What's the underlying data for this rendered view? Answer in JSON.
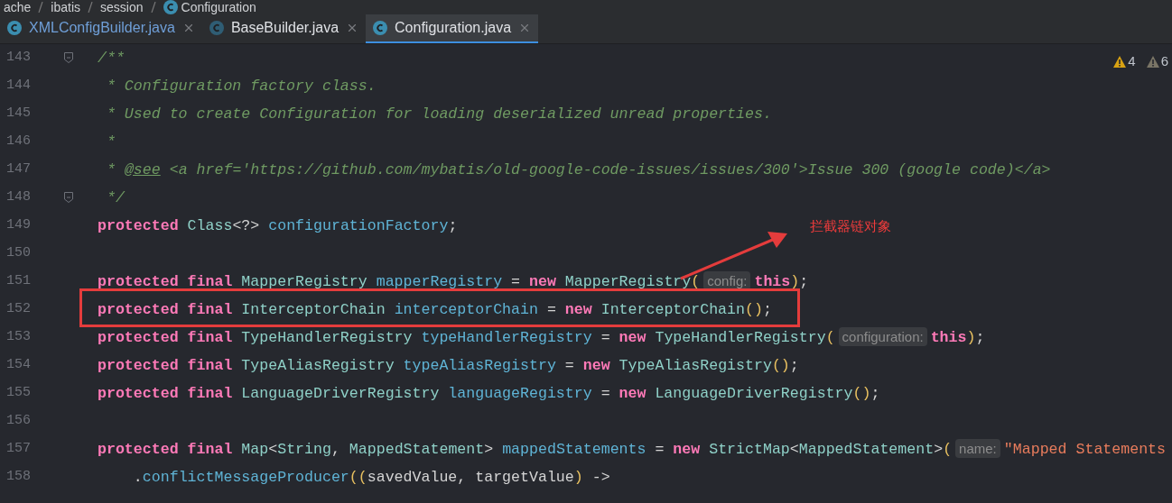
{
  "breadcrumbs": [
    {
      "text": "ache",
      "icon": false
    },
    {
      "text": "ibatis",
      "icon": false
    },
    {
      "text": "session",
      "icon": false
    },
    {
      "text": "Configuration",
      "icon": true
    }
  ],
  "tabs": [
    {
      "label": "XMLConfigBuilder.java",
      "selected": false,
      "modified": true
    },
    {
      "label": "BaseBuilder.java",
      "selected": false,
      "modified": false
    },
    {
      "label": "Configuration.java",
      "selected": true,
      "modified": false
    }
  ],
  "inspections": [
    {
      "kind": "warning",
      "count": "4"
    },
    {
      "kind": "weak",
      "count": "6"
    }
  ],
  "lines": [
    {
      "number": "143",
      "fold": true,
      "tokens": [
        {
          "kind": "comment",
          "text": "/**"
        }
      ]
    },
    {
      "number": "144",
      "fold": false,
      "tokens": [
        {
          "kind": "comment",
          "text": " * Configuration factory class."
        }
      ]
    },
    {
      "number": "145",
      "fold": false,
      "tokens": [
        {
          "kind": "comment",
          "text": " * Used to create Configuration for loading deserialized unread properties."
        }
      ]
    },
    {
      "number": "146",
      "fold": false,
      "tokens": [
        {
          "kind": "comment",
          "text": " *"
        }
      ]
    },
    {
      "number": "147",
      "fold": false,
      "tokens": [
        {
          "kind": "comment",
          "text": " * "
        },
        {
          "kind": "tag",
          "text": "@see"
        },
        {
          "kind": "comment",
          "text": " <a href='https://github.com/mybatis/old-google-code-issues/issues/300'>Issue 300 (google code)</a>"
        }
      ]
    },
    {
      "number": "148",
      "fold": true,
      "tokens": [
        {
          "kind": "comment",
          "text": " */"
        }
      ]
    },
    {
      "number": "149",
      "fold": false,
      "tokens": [
        {
          "kind": "keyword",
          "text": "protected "
        },
        {
          "kind": "type",
          "text": "Class"
        },
        {
          "kind": "plain",
          "text": "<?> "
        },
        {
          "kind": "field",
          "text": "configurationFactory"
        },
        {
          "kind": "plain",
          "text": ";"
        }
      ]
    },
    {
      "number": "150",
      "fold": false
    },
    {
      "number": "151",
      "fold": false,
      "tokens": [
        {
          "kind": "keyword",
          "text": "protected final "
        },
        {
          "kind": "type",
          "text": "MapperRegistry "
        },
        {
          "kind": "field",
          "text": "mapperRegistry"
        },
        {
          "kind": "plain",
          "text": " = "
        },
        {
          "kind": "keyword",
          "text": "new "
        },
        {
          "kind": "type",
          "text": "MapperRegistry"
        },
        {
          "kind": "paren",
          "text": "("
        },
        {
          "kind": "hint",
          "text": "config:"
        },
        {
          "kind": "keyword",
          "text": "this"
        },
        {
          "kind": "paren",
          "text": ")"
        },
        {
          "kind": "plain",
          "text": ";"
        }
      ]
    },
    {
      "number": "152",
      "fold": false,
      "tokens": [
        {
          "kind": "keyword",
          "text": "protected final "
        },
        {
          "kind": "type",
          "text": "InterceptorChain "
        },
        {
          "kind": "field",
          "text": "interceptorChain"
        },
        {
          "kind": "plain",
          "text": " = "
        },
        {
          "kind": "keyword",
          "text": "new "
        },
        {
          "kind": "type",
          "text": "InterceptorChain"
        },
        {
          "kind": "paren",
          "text": "()"
        },
        {
          "kind": "plain",
          "text": ";"
        }
      ]
    },
    {
      "number": "153",
      "fold": false,
      "tokens": [
        {
          "kind": "keyword",
          "text": "protected final "
        },
        {
          "kind": "type",
          "text": "TypeHandlerRegistry "
        },
        {
          "kind": "field",
          "text": "typeHandlerRegistry"
        },
        {
          "kind": "plain",
          "text": " = "
        },
        {
          "kind": "keyword",
          "text": "new "
        },
        {
          "kind": "type",
          "text": "TypeHandlerRegistry"
        },
        {
          "kind": "paren",
          "text": "("
        },
        {
          "kind": "hint",
          "text": "configuration:"
        },
        {
          "kind": "keyword",
          "text": "this"
        },
        {
          "kind": "paren",
          "text": ")"
        },
        {
          "kind": "plain",
          "text": ";"
        }
      ]
    },
    {
      "number": "154",
      "fold": false,
      "tokens": [
        {
          "kind": "keyword",
          "text": "protected final "
        },
        {
          "kind": "type",
          "text": "TypeAliasRegistry "
        },
        {
          "kind": "field",
          "text": "typeAliasRegistry"
        },
        {
          "kind": "plain",
          "text": " = "
        },
        {
          "kind": "keyword",
          "text": "new "
        },
        {
          "kind": "type",
          "text": "TypeAliasRegistry"
        },
        {
          "kind": "paren",
          "text": "()"
        },
        {
          "kind": "plain",
          "text": ";"
        }
      ]
    },
    {
      "number": "155",
      "fold": false,
      "tokens": [
        {
          "kind": "keyword",
          "text": "protected final "
        },
        {
          "kind": "type",
          "text": "LanguageDriverRegistry "
        },
        {
          "kind": "field",
          "text": "languageRegistry"
        },
        {
          "kind": "plain",
          "text": " = "
        },
        {
          "kind": "keyword",
          "text": "new "
        },
        {
          "kind": "type",
          "text": "LanguageDriverRegistry"
        },
        {
          "kind": "paren",
          "text": "()"
        },
        {
          "kind": "plain",
          "text": ";"
        }
      ]
    },
    {
      "number": "156",
      "fold": false
    },
    {
      "number": "157",
      "fold": false,
      "tokens": [
        {
          "kind": "keyword",
          "text": "protected final "
        },
        {
          "kind": "type",
          "text": "Map"
        },
        {
          "kind": "plain",
          "text": "<"
        },
        {
          "kind": "type",
          "text": "String"
        },
        {
          "kind": "plain",
          "text": ", "
        },
        {
          "kind": "type",
          "text": "MappedStatement"
        },
        {
          "kind": "plain",
          "text": "> "
        },
        {
          "kind": "field",
          "text": "mappedStatements"
        },
        {
          "kind": "plain",
          "text": " = "
        },
        {
          "kind": "keyword",
          "text": "new "
        },
        {
          "kind": "type",
          "text": "StrictMap"
        },
        {
          "kind": "plain",
          "text": "<"
        },
        {
          "kind": "type",
          "text": "MappedStatement"
        },
        {
          "kind": "plain",
          "text": ">"
        },
        {
          "kind": "paren",
          "text": "("
        },
        {
          "kind": "hint",
          "text": "name:"
        },
        {
          "kind": "string",
          "text": "\"Mapped Statements"
        }
      ]
    },
    {
      "number": "158",
      "fold": false,
      "tokens": [
        {
          "kind": "plain",
          "text": "    ."
        },
        {
          "kind": "method",
          "text": "conflictMessageProducer"
        },
        {
          "kind": "paren",
          "text": "(("
        },
        {
          "kind": "plain",
          "text": "savedValue, targetValue"
        },
        {
          "kind": "paren",
          "text": ")"
        },
        {
          "kind": "plain",
          "text": " ->"
        }
      ]
    }
  ],
  "annotation": {
    "text": "拦截器链对象"
  }
}
